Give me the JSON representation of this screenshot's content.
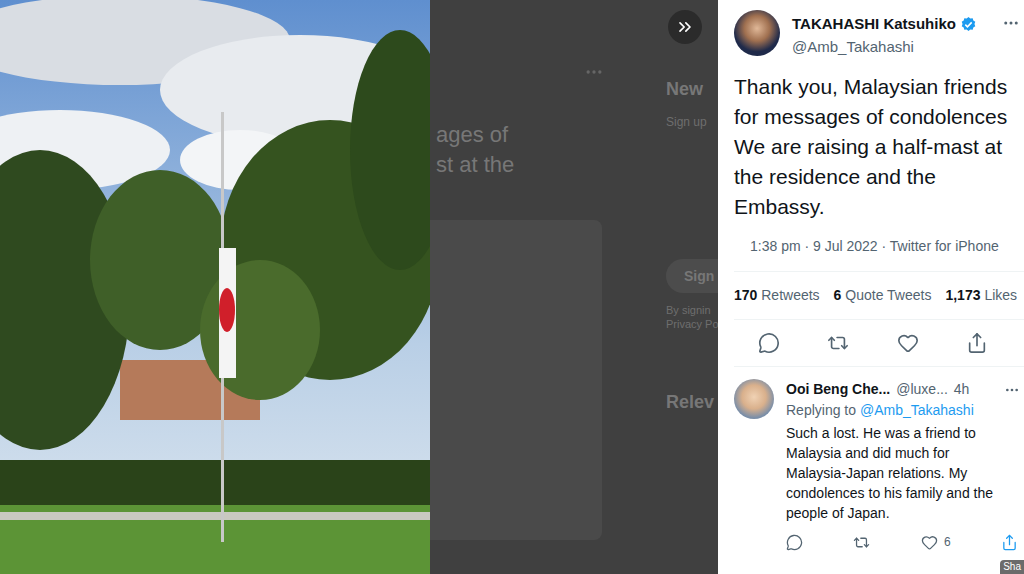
{
  "background_page": {
    "fragments": [
      "ages of",
      "st at the"
    ],
    "sidebar": {
      "heading": "New",
      "subtext": "Sign up",
      "button": "Sign",
      "legal": [
        "By signin",
        "Privacy Po"
      ],
      "related_heading": "Relev"
    }
  },
  "tweet": {
    "author": "TAKAHASHI Katsuhiko",
    "handle": "@Amb_Takahashi",
    "verified": true,
    "lines": [
      "Thank you, Malaysian friends",
      "for messages of condolences",
      "We are raising a half-mast at",
      "the residence and the",
      "Embassy."
    ],
    "timestamp": "1:38 pm · 9 Jul 2022 · Twitter for iPhone",
    "stats": [
      {
        "count": "170",
        "label": "Retweets"
      },
      {
        "count": "6",
        "label": "Quote Tweets"
      },
      {
        "count": "1,173",
        "label": "Likes"
      }
    ]
  },
  "reply": {
    "author": "Ooi Beng Che...",
    "handle": "@luxe...",
    "time": "4h",
    "replying_label": "Replying to",
    "replying_to": "@Amb_Takahashi",
    "text": "Such a lost. He was a friend to Malaysia and did much for Malaysia-Japan relations. My condolences to his family and the people of Japan.",
    "likes": "6"
  },
  "tooltip": "Sha"
}
